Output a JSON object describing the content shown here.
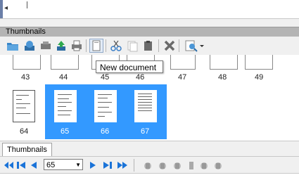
{
  "panel": {
    "title": "Thumbnails"
  },
  "tooltip": {
    "text": "New document"
  },
  "thumbnails_row1": [
    "43",
    "44",
    "45",
    "46",
    "47",
    "48",
    "49"
  ],
  "thumbnails_row2": [
    "64",
    "65",
    "66",
    "67"
  ],
  "selected_pages": [
    "65",
    "66",
    "67"
  ],
  "tabs": [
    {
      "label": "Thumbnails"
    }
  ],
  "navigation": {
    "page_value": "65"
  },
  "colors": {
    "selection": "#3399ff",
    "accent_blue": "#1a73d8"
  }
}
